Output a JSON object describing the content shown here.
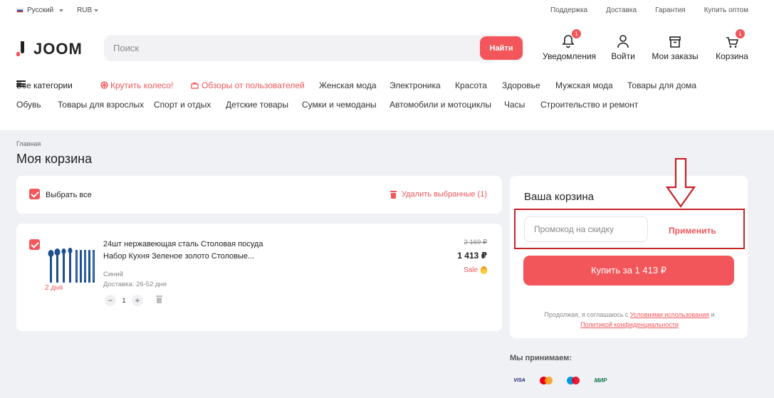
{
  "topbar": {
    "language": "Русский",
    "currency": "RUB",
    "links": [
      "Поддержка",
      "Доставка",
      "Гарантия",
      "Купить оптом"
    ]
  },
  "header": {
    "logo_text": "JOOM",
    "search_placeholder": "Поиск",
    "search_button": "Найти",
    "notifications": {
      "label": "Уведомления",
      "badge": "1",
      "icon": "bell-icon"
    },
    "login": {
      "label": "Войти",
      "icon": "user-icon"
    },
    "orders": {
      "label": "Мои заказы",
      "icon": "box-icon"
    },
    "cart": {
      "label": "Корзина",
      "badge": "1",
      "icon": "cart-icon"
    }
  },
  "categories": {
    "all": "Все категории",
    "row1": [
      "Крутить колесо!",
      "Обзоры от пользователей",
      "Женская мода",
      "Электроника",
      "Красота",
      "Здоровье",
      "Мужская мода",
      "Товары для дома"
    ],
    "row2": [
      "Обувь",
      "Товары для взрослых",
      "Спорт и отдых",
      "Детские товары",
      "Сумки и чемоданы",
      "Автомобили и мотоциклы",
      "Часы",
      "Строительство и ремонт"
    ]
  },
  "page": {
    "breadcrumb": "Главная",
    "title": "Моя корзина"
  },
  "cart": {
    "select_all": "Выбрать все",
    "delete_selected": "Удалить выбранные (1)",
    "item": {
      "name_line1": "24шт нержавеющая сталь Столовая посуда",
      "name_line2": "Набор Кухня Зеленое золото Столовые...",
      "color": "Синий",
      "delivery": "Доставка: 26-52 дня",
      "badge_days": "2 дня",
      "quantity": "1",
      "old_price": "2 169 ₽",
      "price": "1 413 ₽",
      "sale_label": "Sale"
    }
  },
  "summary": {
    "title": "Ваша корзина",
    "promo_placeholder": "Промокод на скидку",
    "apply": "Применить",
    "buy": "Купить за 1 413 ₽",
    "legal_prefix": "Продолжая, я соглашаюсь с",
    "terms_link": "Условиями использования",
    "legal_and": "и",
    "privacy_link": "Политикой конфиденциальности"
  },
  "payments": {
    "title": "Мы принимаем:",
    "methods": [
      "VISA",
      "Mastercard",
      "Maestro",
      "МИР"
    ]
  },
  "colors": {
    "accent": "#f2565a",
    "highlight_box": "#c62228",
    "background": "#f0f1f5"
  }
}
